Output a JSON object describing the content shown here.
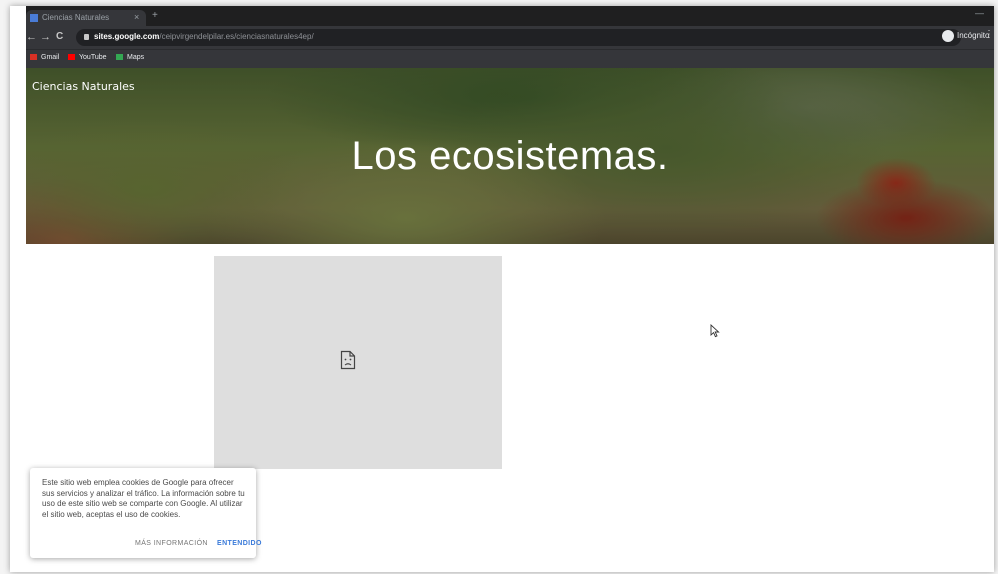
{
  "browser": {
    "tab_title": "Ciencias Naturales",
    "new_tab": "+",
    "window_control": "—",
    "nav": {
      "back": "←",
      "forward": "→",
      "reload": "C"
    },
    "url_host": "sites.google.com",
    "url_path": "/ceipvirgendelpilar.es/cienciasnaturales4ep/",
    "star": "☆",
    "profile_label": "Incógnito",
    "menu": "⋮",
    "bookmarks": [
      {
        "label": "Gmail",
        "color": "#d93025"
      },
      {
        "label": "YouTube",
        "color": "#ff0000"
      },
      {
        "label": "Maps",
        "color": "#34a853"
      }
    ]
  },
  "site": {
    "name": "Ciencias Naturales",
    "hero_title": "Los ecosistemas."
  },
  "embed": {
    "icon": "broken-file-icon"
  },
  "cookie_banner": {
    "text": "Este sitio web emplea cookies de Google para ofrecer sus servicios y analizar el tráfico. La información sobre tu uso de este sitio web se comparte con Google. Al utilizar el sitio web, aceptas el uso de cookies.",
    "more_info": "MÁS INFORMACIÓN",
    "accept": "ENTENDIDO",
    "accent_color": "#3a7ad9"
  }
}
